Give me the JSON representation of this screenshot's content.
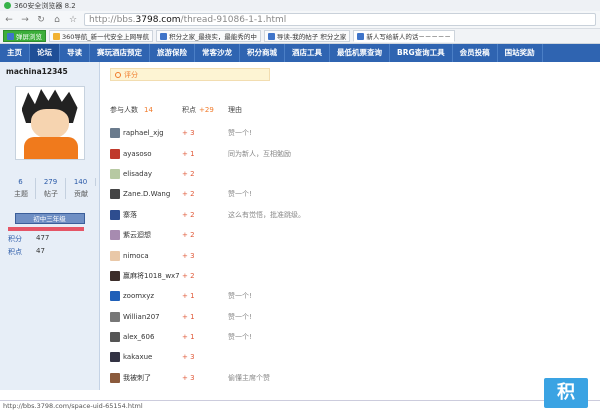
{
  "browser": {
    "title": "360安全浏览器 8.2",
    "url_prefix": "http://bbs.",
    "url_host": "3798.com",
    "url_path": "/thread-91086-1-1.html"
  },
  "favorites": [
    {
      "label": "弹屏浏览"
    },
    {
      "label": "360导航_新一代安全上网导航"
    },
    {
      "label": "积分之家_最挠实，最能秀的中"
    },
    {
      "label": "导读-我的帖子 积分之家"
    },
    {
      "label": "新人写给新人的话－－－－－"
    }
  ],
  "menu": [
    "主页",
    "论坛",
    "导读",
    "赛玩酒店预定",
    "旅游保险",
    "常客沙龙",
    "积分商城",
    "酒店工具",
    "最低机票查询",
    "BRG查询工具",
    "会员投稿",
    "国站奖励"
  ],
  "profile": {
    "username": "machina12345",
    "stats": [
      {
        "num": "6",
        "label": "主题"
      },
      {
        "num": "279",
        "label": "帖子"
      },
      {
        "num": "140",
        "label": "贡献"
      }
    ],
    "rank": "初中三年级",
    "kv": [
      {
        "k": "积分",
        "v": "477"
      },
      {
        "k": "积点",
        "v": "47"
      }
    ]
  },
  "rating": {
    "header": "评分",
    "participants_label": "参与人数",
    "participants_count": "14",
    "points_label": "积点",
    "points_total": "+29",
    "reason_label": "理由",
    "rows": [
      {
        "user": "raphael_xjg",
        "pts": "+ 3",
        "reason": "赞一个!",
        "color": "#6a7b8d"
      },
      {
        "user": "ayasoso",
        "pts": "+ 1",
        "reason": "同为新人，互相勉励",
        "color": "#c0392b"
      },
      {
        "user": "elisaday",
        "pts": "+ 2",
        "reason": "",
        "color": "#b7c9a2"
      },
      {
        "user": "Zane.D.Wang",
        "pts": "+ 2",
        "reason": "赞一个!",
        "color": "#444"
      },
      {
        "user": "寨落",
        "pts": "+ 2",
        "reason": "这么有觉悟，批准跳级。",
        "color": "#2e4d8f"
      },
      {
        "user": "紫云迴想",
        "pts": "+ 2",
        "reason": "",
        "color": "#a78bb0"
      },
      {
        "user": "nimoca",
        "pts": "+ 3",
        "reason": "",
        "color": "#e9c8a8"
      },
      {
        "user": "赢麻将1018_wx7",
        "pts": "+ 2",
        "reason": "",
        "color": "#3b2d2a"
      },
      {
        "user": "zoomxyz",
        "pts": "+ 1",
        "reason": "赞一个!",
        "color": "#1f5fb8"
      },
      {
        "user": "Willian207",
        "pts": "+ 1",
        "reason": "赞一个!",
        "color": "#777"
      },
      {
        "user": "alex_606",
        "pts": "+ 1",
        "reason": "赞一个!",
        "color": "#555"
      },
      {
        "user": "kakaxue",
        "pts": "+ 3",
        "reason": "",
        "color": "#334"
      },
      {
        "user": "我被刺了",
        "pts": "+ 3",
        "reason": "偷懂主席个赞",
        "color": "#8b5a3c"
      }
    ]
  },
  "statusbar": "http://bbs.3798.com/space-uid-65154.html",
  "corner_logo": "积"
}
